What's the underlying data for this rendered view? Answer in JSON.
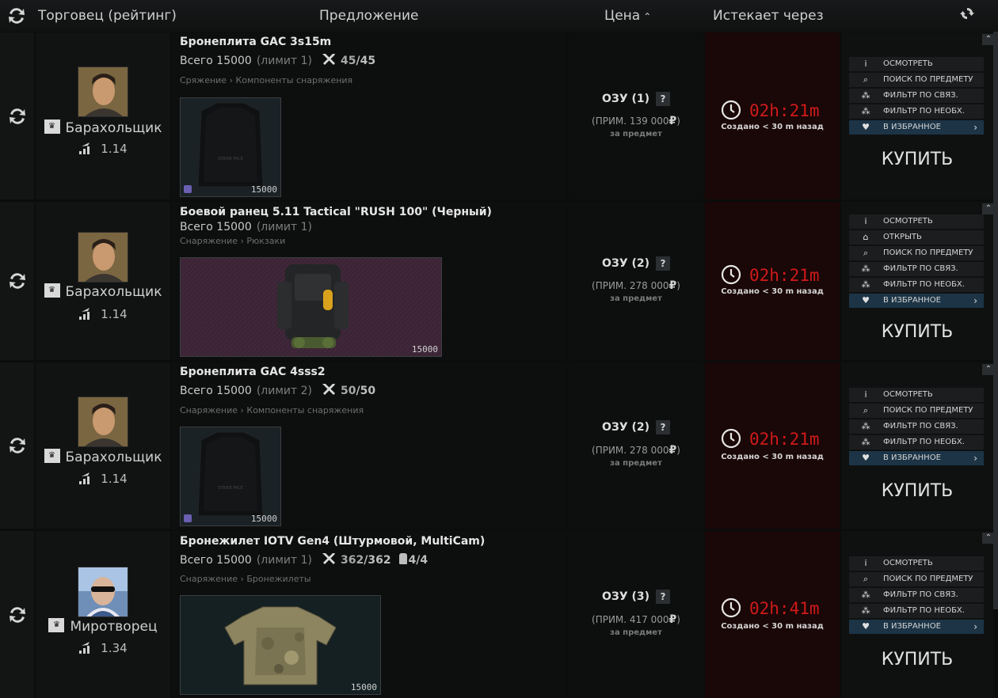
{
  "header": {
    "trader_col": "Торговец (рейтинг)",
    "offer_col": "Предложение",
    "price_col": "Цена",
    "expire_col": "Истекает через",
    "sort_arrow": "⌃"
  },
  "actions_labels": {
    "inspect": "ОСМОТРЕТЬ",
    "open": "ОТКРЫТЬ",
    "search_item": "ПОИСК ПО ПРЕДМЕТУ",
    "filter_linked": "ФИЛЬТР ПО СВЯЗ.",
    "filter_required": "ФИЛЬТР ПО НЕОБХ.",
    "favorite": "В ИЗБРАННОЕ",
    "buy": "КУПИТЬ"
  },
  "offers": [
    {
      "trader": "Барахольщик",
      "rating": "1.14",
      "title": "Бронеплита GAC 3s15m",
      "total": "Всего 15000",
      "limit": "(лимит 1)",
      "durability_cur": "45",
      "durability_max": "/45",
      "category": "Сряжение › Компоненты снаряжения",
      "stack": "15000",
      "price": "ОЗУ (1)",
      "approx": "(ПРИМ. 139 000",
      "approx_close": ")",
      "per": "за предмет",
      "timer": "02h:21m",
      "created": "Создано < 30 m назад"
    },
    {
      "trader": "Барахольщик",
      "rating": "1.14",
      "title": "Боевой ранец 5.11 Tactical \"RUSH 100\" (Черный)",
      "total": "Всего 15000",
      "limit": "(лимит 1)",
      "category": "Снаряжение › Рюкзаки",
      "stack": "15000",
      "price": "ОЗУ (2)",
      "approx": "(ПРИМ. 278 000",
      "approx_close": ")",
      "per": "за предмет",
      "timer": "02h:21m",
      "created": "Создано < 30 m назад"
    },
    {
      "trader": "Барахольщик",
      "rating": "1.14",
      "title": "Бронеплита GAC 4sss2",
      "total": "Всего 15000",
      "limit": "(лимит 2)",
      "durability_cur": "50",
      "durability_max": "/50",
      "category": "Снаряжение › Компоненты снаряжения",
      "stack": "15000",
      "price": "ОЗУ (2)",
      "approx": "(ПРИМ. 278 000",
      "approx_close": ")",
      "per": "за предмет",
      "timer": "02h:21m",
      "created": "Создано < 30 m назад"
    },
    {
      "trader": "Миротворец",
      "rating": "1.34",
      "title": "Бронежилет IOTV Gen4 (Штурмовой, MultiCam)",
      "total": "Всего 15000",
      "limit": "(лимит 1)",
      "durability_cur": "362",
      "durability_max": "/362",
      "plates": "4/4",
      "category": "Снаряжение › Бронежилеты",
      "stack": "15000",
      "price": "ОЗУ (3)",
      "approx": "(ПРИМ. 417 000",
      "approx_close": ")",
      "per": "за предмет",
      "timer": "02h:41m",
      "created": "Создано < 30 m назад"
    }
  ],
  "currency_symbol": "₽",
  "qmark": "?",
  "colors": {
    "timer_red": "#d01a1a",
    "fav_blue": "#1c3446",
    "expire_bg": "#1a0707"
  }
}
